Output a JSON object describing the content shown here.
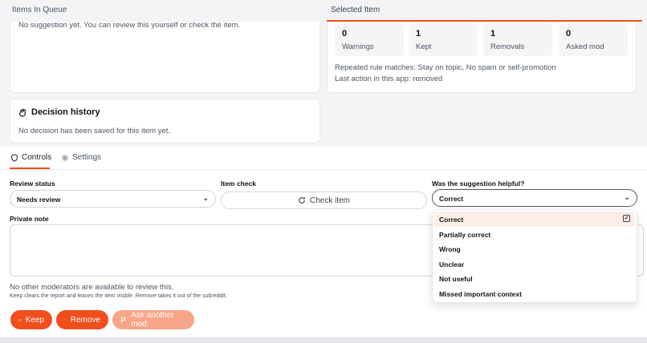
{
  "queue": {
    "header": "Items In Queue",
    "message": "No suggestion yet. You can review this yourself or check the item."
  },
  "selected": {
    "header": "Selected Item",
    "stats": [
      {
        "value": "0",
        "label": "Warnings"
      },
      {
        "value": "1",
        "label": "Kept"
      },
      {
        "value": "1",
        "label": "Removals"
      },
      {
        "value": "0",
        "label": "Asked mod"
      }
    ],
    "rule_matches": "Repeated rule matches: Stay on topic, No spam or self-promotion",
    "last_action": "Last action in this app: removed"
  },
  "history": {
    "title": "Decision history",
    "message": "No decision has been saved for this item yet."
  },
  "tabs": {
    "controls": "Controls",
    "settings": "Settings"
  },
  "form": {
    "review_status_label": "Review status",
    "review_status_value": "Needs review",
    "item_check_label": "Item check",
    "check_button": "Check item",
    "helpful_label": "Was the suggestion helpful?",
    "helpful_value": "Correct",
    "note_label": "Private note",
    "helpful_options": [
      "Correct",
      "Partially correct",
      "Wrong",
      "Unclear",
      "Not useful",
      "Missed important context"
    ]
  },
  "info": {
    "no_mods": "No other moderators are available to review this.",
    "hint": "Keep clears the report and leaves the item visible. Remove takes it out of the subreddit."
  },
  "actions": {
    "keep": "Keep",
    "remove": "Remove",
    "ask": "Ask another mod"
  },
  "colors": {
    "accent": "#f04e1d",
    "accent_disabled": "#f9a58a"
  }
}
